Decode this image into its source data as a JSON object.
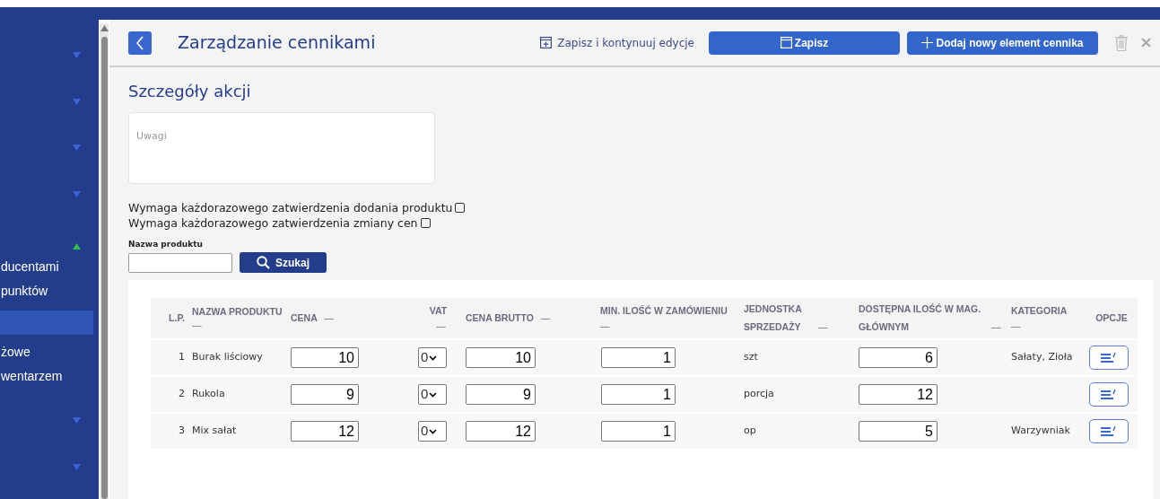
{
  "sidebar": {
    "items": [
      {
        "expanded": false
      },
      {
        "expanded": false
      },
      {
        "expanded": false
      },
      {
        "expanded": false
      },
      {
        "expanded": true,
        "children": [
          {
            "label": "ducentami",
            "selected": false
          },
          {
            "label": "punktów",
            "selected": false
          },
          {
            "selected": true
          },
          {
            "label": "żowe",
            "selected": false
          },
          {
            "label": "wentarzem",
            "selected": false
          }
        ]
      },
      {
        "expanded": false
      },
      {
        "expanded": false
      }
    ]
  },
  "header": {
    "title": "Zarządzanie cennikami",
    "save_continue": "Zapisz i kontynuuj edycje",
    "save": "Zapisz",
    "add": "Dodaj nowy element cennika",
    "delete_disabled": true
  },
  "details": {
    "title": "Szczegóły akcji",
    "notes": {
      "placeholder": "Uwagi"
    },
    "checkboxes": [
      {
        "label": "Wymaga każdorazowego zatwierdzenia dodania produktu",
        "checked": false
      },
      {
        "label": "Wymaga każdorazowego zatwierdzenia zmiany cen",
        "checked": false
      }
    ]
  },
  "search": {
    "label": "Nazwa produktu",
    "button": "Szukaj"
  },
  "table": {
    "columns": [
      {
        "label": "L.P."
      },
      {
        "label": "NAZWA PRODUKTU",
        "sort_mark": "—"
      },
      {
        "label": "CENA",
        "sort_mark": "—"
      },
      {
        "label": "VAT",
        "sort_mark": "—"
      },
      {
        "label": "CENA BRUTTO",
        "sort_mark": "—"
      },
      {
        "label": "MIN. ILOŚĆ W ZAMÓWIENIU",
        "sort_mark": "—"
      },
      {
        "label": "JEDNOSTKA SPRZEDAŻY",
        "sort_mark": "—"
      },
      {
        "label": "DOSTĘPNA ILOŚĆ W MAG. GŁÓWNYM",
        "sort_mark": "—"
      },
      {
        "label": "KATEGORIA",
        "sort_mark": "—"
      },
      {
        "label": "OPCJE"
      }
    ],
    "rows": [
      {
        "lp": "1",
        "name": "Burak liściowy",
        "price": "10",
        "vat": "0",
        "gross": "10",
        "min_qty": "1",
        "unit": "szt",
        "available": "6",
        "category": "Sałaty, Zioła"
      },
      {
        "lp": "2",
        "name": "Rukola",
        "price": "9",
        "vat": "0",
        "gross": "9",
        "min_qty": "1",
        "unit": "porcja",
        "available": "12"
      },
      {
        "lp": "3",
        "name": "Mix sałat",
        "price": "12",
        "vat": "0",
        "gross": "12",
        "min_qty": "1",
        "unit": "op",
        "available": "5",
        "category": "Warzywniak"
      }
    ]
  }
}
